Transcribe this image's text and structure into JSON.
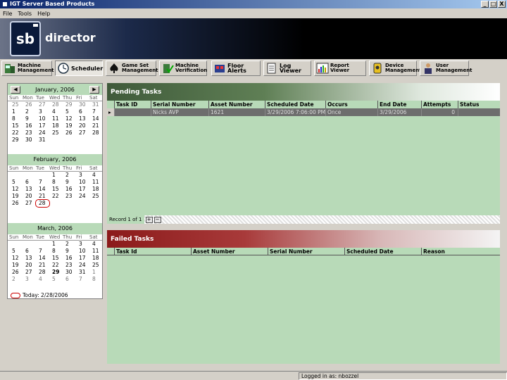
{
  "window": {
    "title": "IGT Server Based Products",
    "controls": [
      "_",
      "□",
      "X"
    ]
  },
  "menu": [
    "File",
    "Tools",
    "Help"
  ],
  "banner": {
    "logo_text": "sb",
    "brand": "director"
  },
  "toolbar": [
    {
      "label": "Machine\nManagement",
      "icon": "machine-icon"
    },
    {
      "label": "Scheduler",
      "icon": "clock-icon",
      "active": true
    },
    {
      "label": "Game Set\nManagement",
      "icon": "spade-icon"
    },
    {
      "label": "Machine\nVerification",
      "icon": "check-machine-icon"
    },
    {
      "label": "Floor Alerts",
      "icon": "alert-icon"
    },
    {
      "label": "Log Viewer",
      "icon": "log-icon"
    },
    {
      "label": "Report\nViewer",
      "icon": "report-icon"
    },
    {
      "label": "Device\nManagement",
      "icon": "device-icon"
    },
    {
      "label": "User\nManagement",
      "icon": "user-icon"
    }
  ],
  "calendar": {
    "nav_prev": "◀",
    "nav_next": "▶",
    "dow": [
      "Sun",
      "Mon",
      "Tue",
      "Wed",
      "Thu",
      "Fri",
      "Sat"
    ],
    "months": [
      {
        "title": "January, 2006",
        "days": [
          "25",
          "26",
          "27",
          "28",
          "29",
          "30",
          "31",
          "1",
          "2",
          "3",
          "4",
          "5",
          "6",
          "7",
          "8",
          "9",
          "10",
          "11",
          "12",
          "13",
          "14",
          "15",
          "16",
          "17",
          "18",
          "19",
          "20",
          "21",
          "22",
          "23",
          "24",
          "25",
          "26",
          "27",
          "28",
          "29",
          "30",
          "31",
          "",
          "",
          "",
          ""
        ],
        "dim_first": 7,
        "dim_last": 0
      },
      {
        "title": "February, 2006",
        "days": [
          "",
          "",
          "",
          "1",
          "2",
          "3",
          "4",
          "5",
          "6",
          "7",
          "8",
          "9",
          "10",
          "11",
          "12",
          "13",
          "14",
          "15",
          "16",
          "17",
          "18",
          "19",
          "20",
          "21",
          "22",
          "23",
          "24",
          "25",
          "26",
          "27",
          "28"
        ],
        "circled": "28"
      },
      {
        "title": "March, 2006",
        "days": [
          "",
          "",
          "",
          "1",
          "2",
          "3",
          "4",
          "5",
          "6",
          "7",
          "8",
          "9",
          "10",
          "11",
          "12",
          "13",
          "14",
          "15",
          "16",
          "17",
          "18",
          "19",
          "20",
          "21",
          "22",
          "23",
          "24",
          "25",
          "26",
          "27",
          "28",
          "29",
          "30",
          "31",
          "1",
          "2",
          "3",
          "4",
          "5",
          "6",
          "7",
          "8"
        ],
        "bold": "29"
      }
    ],
    "today_label": "Today: 2/28/2006"
  },
  "pending": {
    "title": "Pending Tasks",
    "columns": [
      "Task ID",
      "Serial Number",
      "Asset Number",
      "Scheduled Date",
      "Occurs",
      "End Date",
      "Attempts",
      "Status"
    ],
    "rows": [
      [
        "",
        "Nicks AVP",
        "1621",
        "3/29/2006 7:06:00 PM",
        "Once",
        "3/29/2006",
        "0",
        ""
      ]
    ],
    "record_label": "Record 1 of 1"
  },
  "failed": {
    "title": "Failed Tasks",
    "columns": [
      "Task Id",
      "Asset Number",
      "Serial Number",
      "Scheduled Date",
      "Reason"
    ]
  },
  "status": {
    "message": "Logged in as: nbozzel"
  },
  "colors": {
    "panel_green": "#b8dab8",
    "pending_header": "#3f5a3a",
    "failed_header": "#8b1a1a"
  }
}
